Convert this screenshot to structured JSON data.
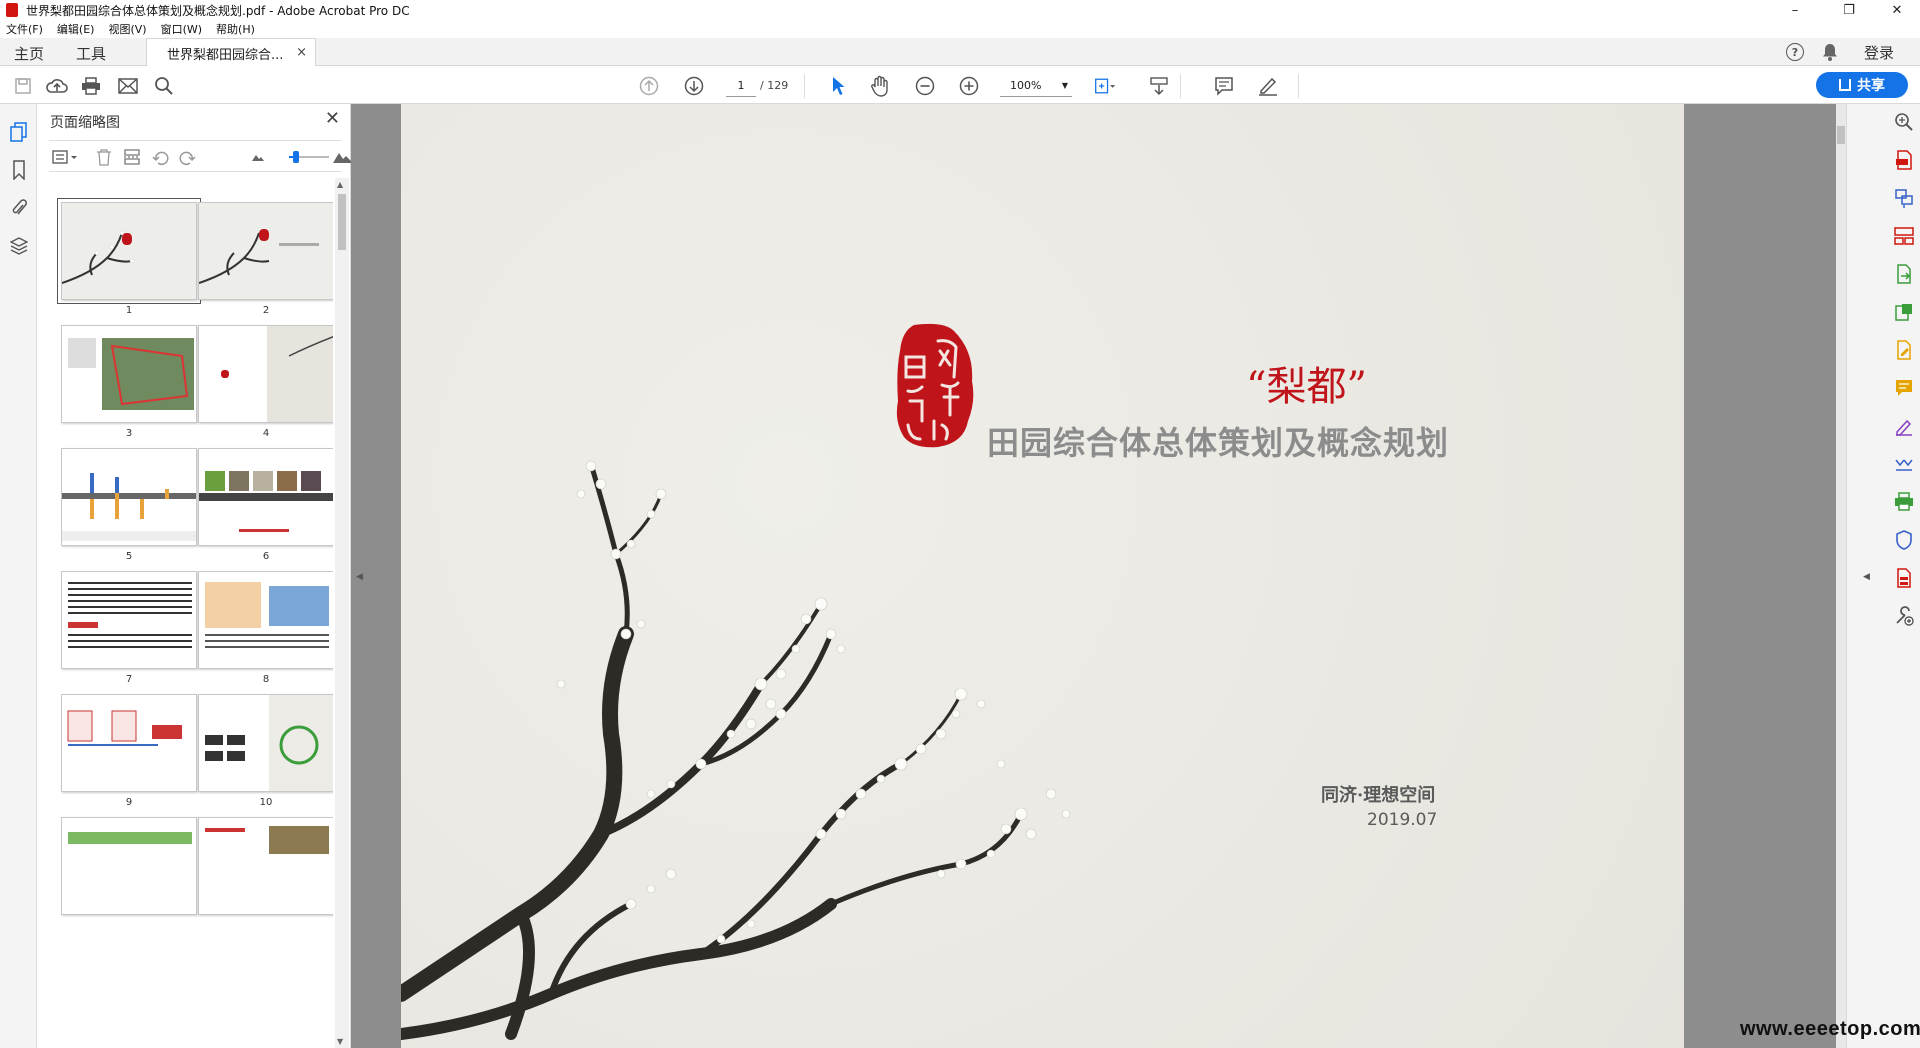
{
  "window": {
    "title": "世界梨都田园综合体总体策划及概念规划.pdf - Adobe Acrobat Pro DC",
    "minimize": "–",
    "maximize": "❐",
    "close": "✕"
  },
  "menu": [
    "文件(F)",
    "编辑(E)",
    "视图(V)",
    "窗口(W)",
    "帮助(H)"
  ],
  "tabs": {
    "home": "主页",
    "tools": "工具",
    "document": "世界梨都田园综合...",
    "document_close": "×",
    "help": "?",
    "login": "登录"
  },
  "toolbar": {
    "current_page": "1",
    "total_pages": "/ 129",
    "zoom": "100%",
    "share_label": "共享"
  },
  "thumbnail_panel": {
    "title": "页面缩略图",
    "close": "✕",
    "pages": [
      "1",
      "2",
      "3",
      "4",
      "5",
      "6",
      "7",
      "8",
      "9",
      "10"
    ]
  },
  "document": {
    "seal_text": "凤凰砀山",
    "title_quote": "“梨都”",
    "title_main": "田园综合体总体策划及概念规划",
    "author": "同济·理想空间",
    "date": "2019.07"
  },
  "watermark": "www.eeeetop.com",
  "colors": {
    "accent": "#1473e6",
    "seal_red": "#c0141b",
    "page_bg": "#ecebe6",
    "right_rail_icons": [
      "#d1160f",
      "#3762c8",
      "#d1160f",
      "#3a9d3a",
      "#3a9d3a",
      "#e6a400",
      "#e6a400",
      "#8a3fbf",
      "#3762c8",
      "#3a9d3a",
      "#3762c8",
      "#d1160f",
      "#555555"
    ]
  }
}
